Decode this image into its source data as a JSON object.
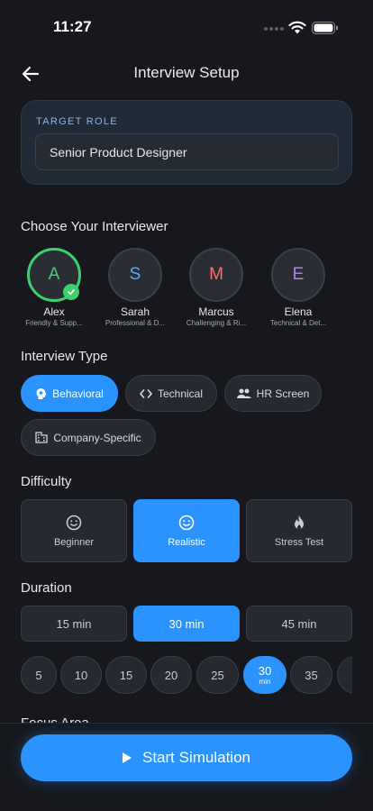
{
  "status": {
    "time": "11:27"
  },
  "header": {
    "title": "Interview Setup"
  },
  "role": {
    "label": "TARGET ROLE",
    "value": "Senior Product Designer"
  },
  "interviewers": {
    "title": "Choose Your Interviewer",
    "items": [
      {
        "initial": "A",
        "name": "Alex",
        "desc": "Friendly & Supp...",
        "color": "#3ecf6e",
        "selected": true
      },
      {
        "initial": "S",
        "name": "Sarah",
        "desc": "Professional & D...",
        "color": "#5aa8ff",
        "selected": false
      },
      {
        "initial": "M",
        "name": "Marcus",
        "desc": "Challenging & Ri...",
        "color": "#ff6b6b",
        "selected": false
      },
      {
        "initial": "E",
        "name": "Elena",
        "desc": "Technical & Det...",
        "color": "#b57cf0",
        "selected": false
      }
    ]
  },
  "interview_type": {
    "title": "Interview Type",
    "options": [
      {
        "label": "Behavioral",
        "icon": "head-brain-icon",
        "active": true
      },
      {
        "label": "Technical",
        "icon": "code-icon",
        "active": false
      },
      {
        "label": "HR Screen",
        "icon": "people-icon",
        "active": false
      },
      {
        "label": "Company-Specific",
        "icon": "building-icon",
        "active": false
      }
    ]
  },
  "difficulty": {
    "title": "Difficulty",
    "options": [
      {
        "label": "Beginner",
        "icon": "smile-icon",
        "active": false
      },
      {
        "label": "Realistic",
        "icon": "smile-icon",
        "active": true
      },
      {
        "label": "Stress Test",
        "icon": "flame-icon",
        "active": false
      }
    ]
  },
  "duration": {
    "title": "Duration",
    "presets": [
      "15 min",
      "30 min",
      "45 min"
    ],
    "active_preset": "30 min",
    "minutes": [
      "5",
      "10",
      "15",
      "20",
      "25",
      "30",
      "35"
    ],
    "active_minute": "30",
    "minute_unit": "min"
  },
  "focus": {
    "title": "Focus Area"
  },
  "cta": {
    "label": "Start Simulation"
  },
  "colors": {
    "accent": "#2b93ff",
    "success": "#3ecf6e",
    "background": "#16181d"
  }
}
